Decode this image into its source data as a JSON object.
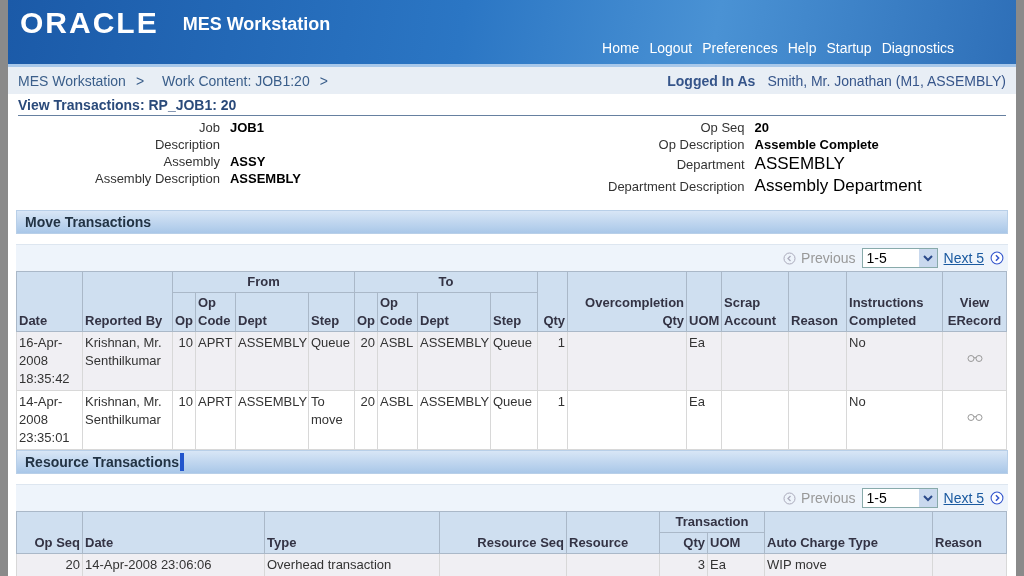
{
  "header": {
    "logo": "ORACLE",
    "app_title": "MES Workstation",
    "nav": [
      "Home",
      "Logout",
      "Preferences",
      "Help",
      "Startup",
      "Diagnostics"
    ]
  },
  "breadcrumbs": [
    "MES Workstation",
    "Work Content: JOB1:20"
  ],
  "breadcrumb_separator": ">",
  "logged_in": {
    "label": "Logged In As",
    "value": "Smith, Mr. Jonathan (M1, ASSEMBLY)"
  },
  "page_title": "View Transactions: RP_JOB1: 20",
  "details_left": [
    {
      "label": "Job",
      "value": "JOB1"
    },
    {
      "label": "Description"
    },
    {
      "label": "Assembly",
      "value": "ASSY"
    },
    {
      "label": "Assembly Description",
      "value": "ASSEMBLY"
    }
  ],
  "details_right": [
    {
      "label": "Op Seq",
      "value": "20",
      "kind": "bold"
    },
    {
      "label": "Op Description",
      "value": "Assemble Complete",
      "kind": "bold"
    },
    {
      "label": "Department",
      "value": "ASSEMBLY",
      "kind": "large"
    },
    {
      "label": "Department Description",
      "value": "Assembly Department",
      "kind": "large"
    }
  ],
  "sections": [
    {
      "title": "Move Transactions",
      "focused": false,
      "pager": {
        "previous": "Previous",
        "previous_disabled": true,
        "range": "1-5",
        "next": "Next 5"
      },
      "columns": [
        {
          "label": "Date",
          "kind": "text"
        },
        {
          "label": "Reported By",
          "kind": "text"
        },
        {
          "group": "From",
          "colspan": 4,
          "columns": [
            {
              "label": "Op",
              "kind": "number"
            },
            {
              "label": "Op Code",
              "kind": "text"
            },
            {
              "label": "Dept",
              "kind": "text"
            },
            {
              "label": "Step",
              "kind": "text"
            }
          ]
        },
        {
          "group": "To",
          "colspan": 4,
          "columns": [
            {
              "label": "Op",
              "kind": "number"
            },
            {
              "label": "Op Code",
              "kind": "text"
            },
            {
              "label": "Dept",
              "kind": "text"
            },
            {
              "label": "Step",
              "kind": "text"
            }
          ]
        },
        {
          "label": "Qty",
          "kind": "number"
        },
        {
          "label": "Overcompletion Qty",
          "kind": "number"
        },
        {
          "label": "UOM",
          "kind": "text"
        },
        {
          "label": "Scrap Account",
          "kind": "text"
        },
        {
          "label": "Reason",
          "kind": "text"
        },
        {
          "label": "Instructions Completed",
          "kind": "text"
        },
        {
          "label": "View ERecord",
          "kind": "icon"
        }
      ],
      "rows": [
        {
          "cells": [
            "16-Apr-2008 18:35:42",
            "Krishnan, Mr. Senthilkumar",
            "10",
            "APRT",
            "ASSEMBLY",
            "Queue",
            "20",
            "ASBL",
            "ASSEMBLY",
            "Queue",
            "1",
            null,
            "Ea",
            null,
            null,
            "No",
            null
          ]
        },
        {
          "cells": [
            "14-Apr-2008 23:35:01",
            "Krishnan, Mr. Senthilkumar",
            "10",
            "APRT",
            "ASSEMBLY",
            "To move",
            "20",
            "ASBL",
            "ASSEMBLY",
            "Queue",
            "1",
            null,
            "Ea",
            null,
            null,
            "No",
            null
          ]
        }
      ]
    },
    {
      "title": "Resource Transactions",
      "focused": true,
      "pager": {
        "previous": "Previous",
        "previous_disabled": true,
        "range": "1-5",
        "next": "Next 5"
      },
      "columns": [
        {
          "label": "Op Seq",
          "kind": "number"
        },
        {
          "label": "Date",
          "kind": "text"
        },
        {
          "label": "Type",
          "kind": "text"
        },
        {
          "label": "Resource Seq",
          "kind": "number"
        },
        {
          "label": "Resource",
          "kind": "text"
        },
        {
          "group": "Transaction",
          "colspan": 2,
          "columns": [
            {
              "label": "Qty",
              "kind": "number"
            },
            {
              "label": "UOM",
              "kind": "text"
            }
          ]
        },
        {
          "label": "Auto Charge Type",
          "kind": "text"
        },
        {
          "label": "Reason",
          "kind": "text"
        }
      ],
      "rows": [
        {
          "cells": [
            "20",
            "14-Apr-2008 23:06:06",
            "Overhead transaction",
            null,
            null,
            "3",
            "Ea",
            "WIP move",
            null
          ]
        }
      ]
    }
  ]
}
